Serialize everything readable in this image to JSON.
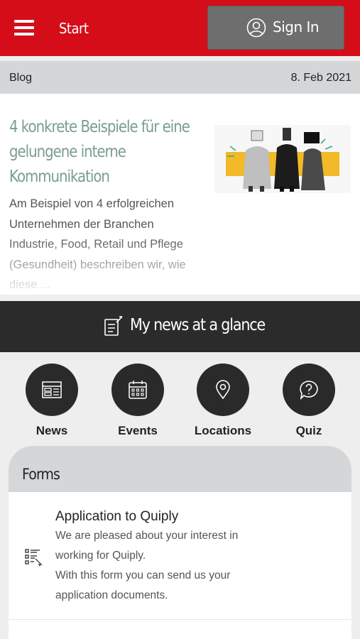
{
  "header": {
    "title": "Start",
    "sign_in_label": "Sign In",
    "accent": "#d40d19"
  },
  "blog": {
    "section_label": "Blog",
    "date": "8. Feb 2021",
    "article": {
      "title": "4 konkrete Beispiele für eine gelungene interne Kommunikation",
      "excerpt": "Am Beispiel von 4 erfolgreichen Unternehmen der Branchen Industrie, Food, Retail und Pflege  (Gesundheit) beschreiben wir, wie diese ..."
    }
  },
  "glance": {
    "title": "My news at a glance"
  },
  "quick_links": [
    {
      "label": "News",
      "icon": "news-icon"
    },
    {
      "label": "Events",
      "icon": "calendar-icon"
    },
    {
      "label": "Locations",
      "icon": "location-pin-icon"
    },
    {
      "label": "Quiz",
      "icon": "quiz-bubble-icon"
    }
  ],
  "forms": {
    "title": "Forms",
    "items": [
      {
        "title": "Application to Quiply",
        "description_line1": "We are pleased about your interest in working for Quiply.",
        "description_line2": "With this form you can send us your application documents.",
        "icon": "form-list-icon"
      }
    ]
  }
}
